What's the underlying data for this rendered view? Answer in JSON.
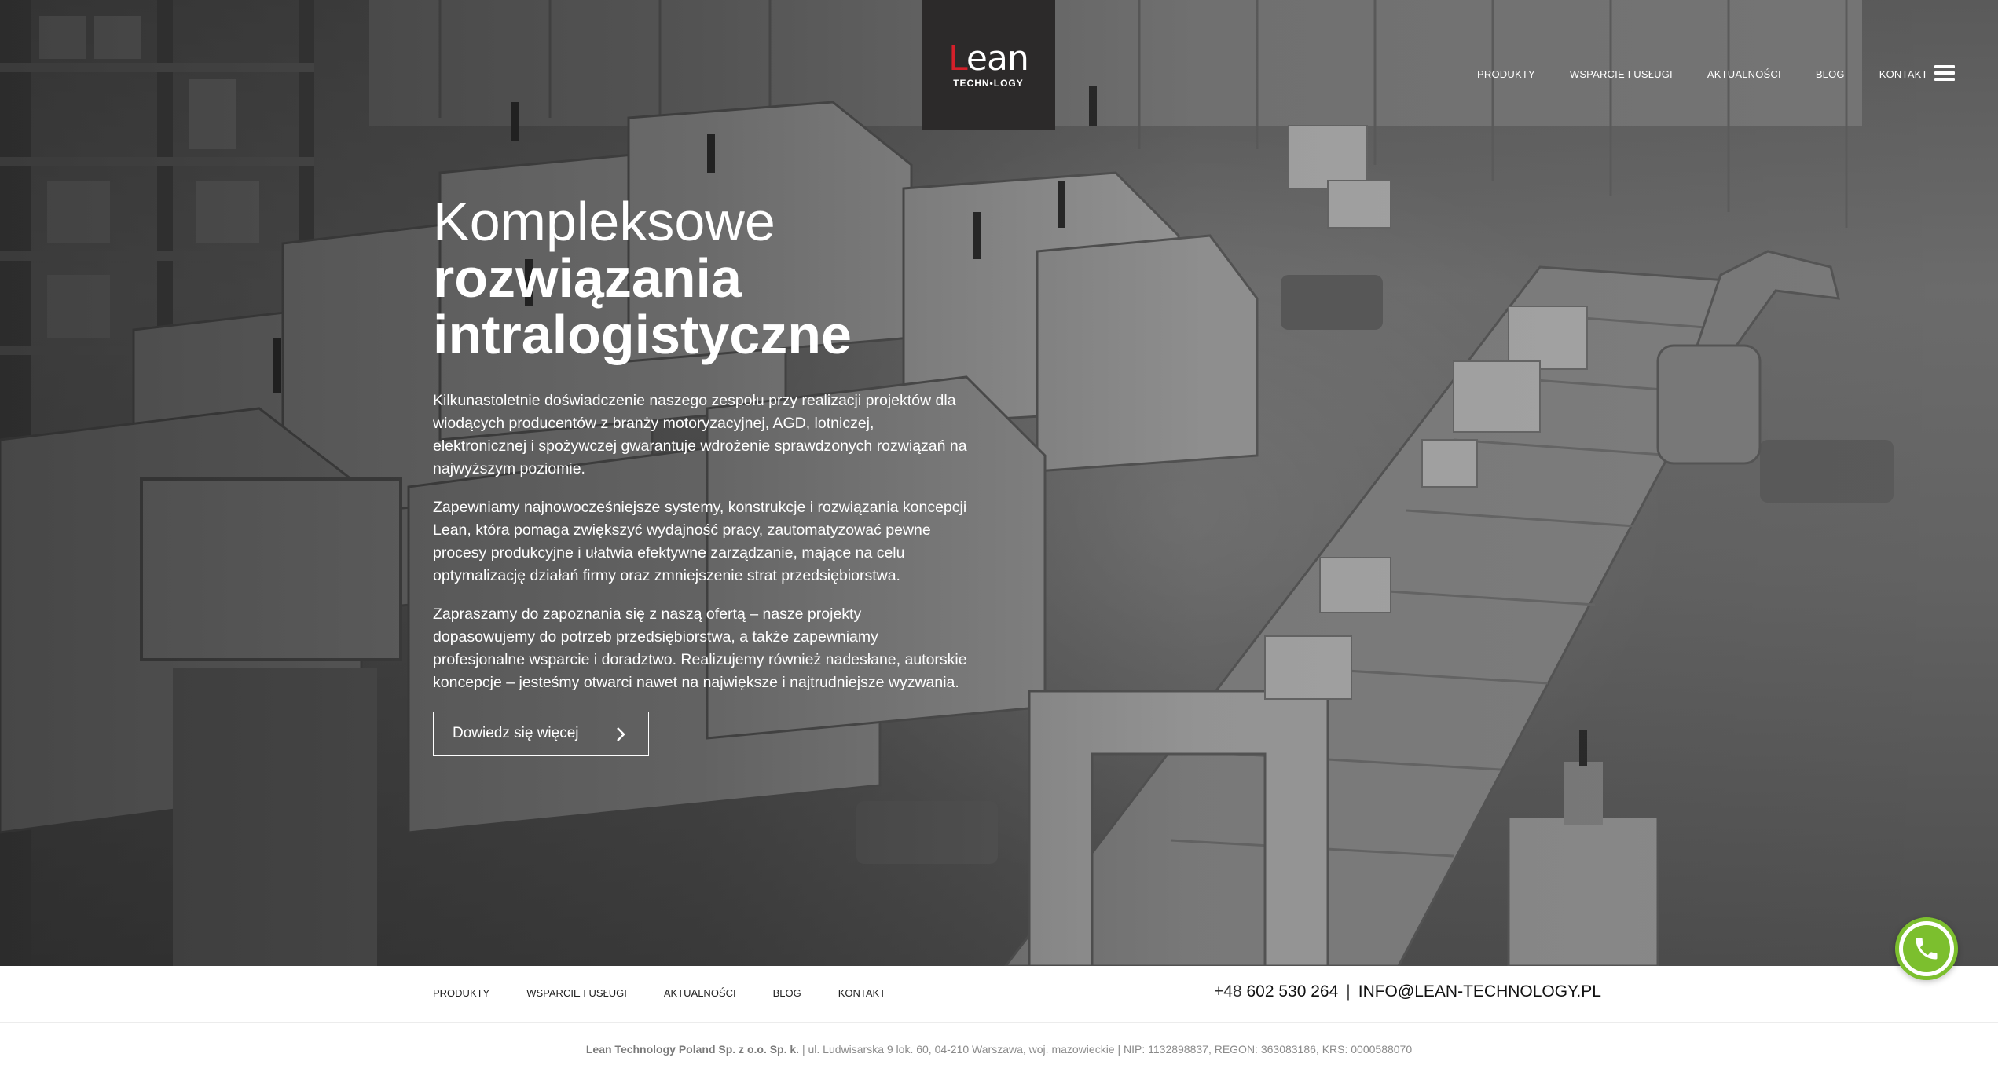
{
  "brand": {
    "logo_word_first": "L",
    "logo_word_rest": "ean",
    "logo_sub": "TECHN•LOGY",
    "logo_alt": "Lean Technology"
  },
  "topnav": {
    "items": [
      {
        "label": "PRODUKTY"
      },
      {
        "label": "WSPARCIE I USŁUGI"
      },
      {
        "label": "AKTUALNOŚCI"
      },
      {
        "label": "BLOG"
      },
      {
        "label": "KONTAKT"
      }
    ],
    "menu_icon": "hamburger-icon"
  },
  "hero": {
    "headline_line1": "Kompleksowe",
    "headline_line2": "rozwiązania",
    "headline_line3": "intralogistyczne",
    "paragraphs": [
      "Kilkunastoletnie doświadczenie naszego zespołu przy realizacji projektów dla wiodących producentów z branży motoryzacyjnej, AGD, lotniczej, elektronicznej i spożywczej gwarantuje wdrożenie sprawdzonych rozwiązań na najwyższym poziomie.",
      "Zapewniamy najnowocześniejsze systemy, konstrukcje i rozwiązania koncepcji Lean, która pomaga zwiększyć wydajność pracy, zautomatyzować pewne procesy produkcyjne i ułatwia efektywne zarządzanie, mające na celu optymalizację działań firmy oraz zmniejszenie strat przedsiębiorstwa.",
      "Zapraszamy do zapoznania się z naszą ofertą – nasze projekty dopasowujemy do potrzeb przedsiębiorstwa, a także zapewniamy profesjonalne wsparcie i doradztwo. Realizujemy również nadesłane, autorskie koncepcje – jesteśmy otwarci nawet na największe i najtrudniejsze wyzwania."
    ],
    "cta_label": "Dowiedz się więcej"
  },
  "footer": {
    "nav": [
      {
        "label": "PRODUKTY"
      },
      {
        "label": "WSPARCIE I USŁUGI"
      },
      {
        "label": "AKTUALNOŚCI"
      },
      {
        "label": "BLOG"
      },
      {
        "label": "KONTAKT"
      }
    ],
    "phone_prefix": "+48",
    "phone_number": "602 530 264",
    "separator": "|",
    "email": "INFO@LEAN-TECHNOLOGY.PL",
    "legal_company": "Lean Technology Poland Sp. z o.o. Sp. k.",
    "legal_rest": " | ul. Ludwisarska 9 lok. 60, 04-210 Warszawa, woj. mazowieckie | NIP: 1132898837, REGON: 363083186, KRS: 0000588070"
  },
  "colors": {
    "accent_red": "#d4202a",
    "phone_green": "#7cbf2e",
    "logo_bg": "#2c2a2a"
  }
}
